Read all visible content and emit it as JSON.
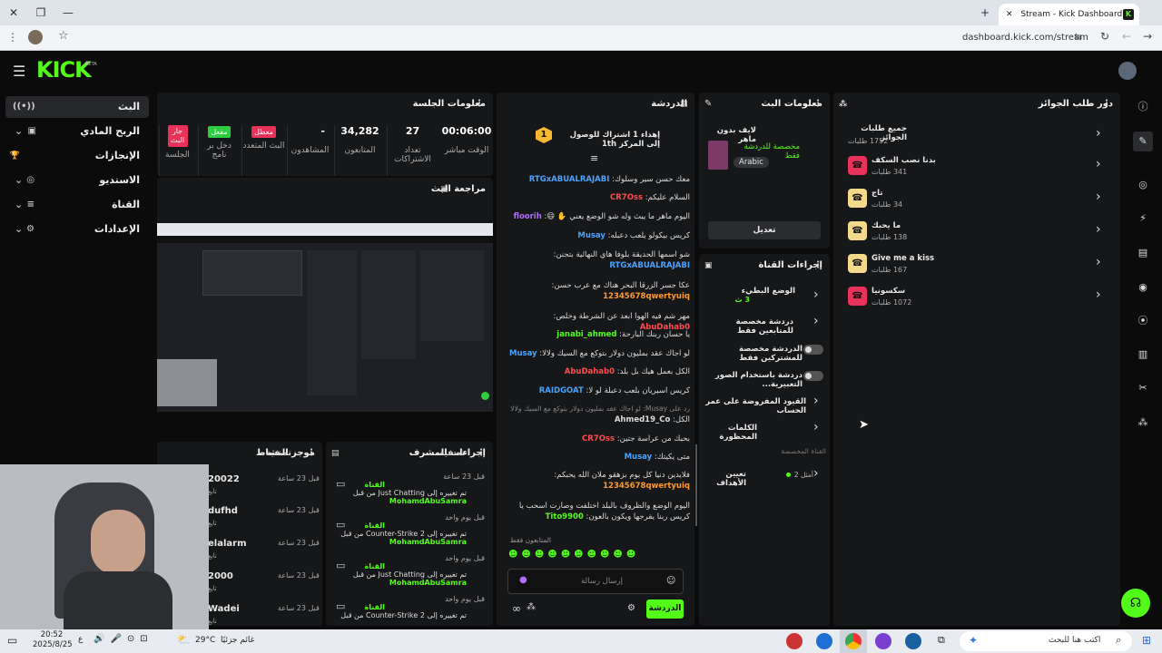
{
  "browser": {
    "tab_title": "Stream - Kick Dashboard",
    "url": "dashboard.kick.com/stream",
    "min": "—",
    "restore": "❐",
    "close": "✕",
    "newtab": "+"
  },
  "header": {
    "logo": "KICK",
    "beta": "BETA"
  },
  "sidebar": {
    "items": [
      {
        "label": "البث",
        "icon": "((•))"
      },
      {
        "label": "الربح المادي",
        "icon": "▣"
      },
      {
        "label": "الإنجازات",
        "icon": "🏆"
      },
      {
        "label": "الاستديو",
        "icon": "◎"
      },
      {
        "label": "القناة",
        "icon": "≡"
      },
      {
        "label": "الإعدادات",
        "icon": "⚙"
      }
    ]
  },
  "session": {
    "title": "معلومات الجلسة",
    "stats": [
      {
        "value": "00:06:00",
        "label": "الوقت مباشر"
      },
      {
        "value": "27",
        "label": "تعداد الاشتراكات"
      },
      {
        "value": "34,282",
        "label": "المتابعون"
      },
      {
        "value": "-",
        "label": "المشاهدون"
      },
      {
        "value": "معطل",
        "label": "البث المتعدد"
      },
      {
        "value": "مفعل",
        "label": "دخل بر نامج"
      },
      {
        "value": "جار البث",
        "label": "الجلسة"
      }
    ]
  },
  "preview": {
    "title": "مراجعة البث"
  },
  "activity": {
    "title": "موجز النشاط",
    "filter": "تصفية",
    "items": [
      {
        "name": "20022",
        "sub": "تابع",
        "time": "قبل 23 ساعة"
      },
      {
        "name": "dufhd",
        "sub": "تابع",
        "time": "قبل 23 ساعة"
      },
      {
        "name": "elalarm",
        "sub": "تابع",
        "time": "قبل 23 ساعة"
      },
      {
        "name": "2000",
        "sub": "تابع",
        "time": "قبل 23 ساعة"
      },
      {
        "name": "Wadei",
        "sub": "تابع",
        "time": "قبل 23 ساعة"
      }
    ]
  },
  "modactions": {
    "title": "إجراءات المشرف",
    "filter": "تصفية",
    "items": [
      {
        "time": "قبل 23 ساعة",
        "head": "القناة",
        "line1": "تم تغييره إلى Just Chatting من قبل",
        "line2": "MohamdAbuSamra"
      },
      {
        "time": "قبل يوم واحد",
        "head": "القناة",
        "line1": "تم تغييره إلى Counter-Strike 2 من قبل",
        "line2": "MohamdAbuSamra"
      },
      {
        "time": "قبل يوم واحد",
        "head": "القناة",
        "line1": "تم تغييره إلى Just Chatting من قبل",
        "line2": "MohamdAbuSamra"
      },
      {
        "time": "قبل يوم واحد",
        "head": "القناة",
        "line1": "تم تغييره إلى Counter-Strike 2 من قبل",
        "line2": ""
      }
    ]
  },
  "chat": {
    "title": "الدردشة",
    "pinned": "إهداء 1 اشتراك للوصول إلى المركز 1th",
    "messages": [
      {
        "user": "RTGxABUALRAJABI",
        "color": "#4aa3ff",
        "text": "معك حسن سير وسلوك"
      },
      {
        "user": "CR7Oss",
        "color": "#ff4d4d",
        "text": "السلام عليكم"
      },
      {
        "user": "floorih",
        "color": "#b46bff",
        "text": "اليوم ماهر ما يبث وله شو الوضع يعني ✋ 😄"
      },
      {
        "user": "Musay",
        "color": "#4aa3ff",
        "text": "كريس بيكولو يلعب دعبله"
      },
      {
        "user": "RTGxABUALRAJABI",
        "color": "#4aa3ff",
        "text": "شو اسمها الحديقة بلوفا هاي النهائية بتجنن"
      },
      {
        "user": "12345678qwertyuiq",
        "color": "#ff9a2e",
        "text": "عكا جسر الزرقا البحر هناك مع عرب حسن"
      },
      {
        "user": "AbuDahab0",
        "color": "#ff4d4d",
        "text": "مهر شم فيه الهوا ابعد عن الشرطة وخلص"
      },
      {
        "user": "janabi_ahmed",
        "color": "#53fc18",
        "text": "يا حسان ربنك البارحة"
      },
      {
        "user": "Musay",
        "color": "#4aa3ff",
        "text": "لو اجاك عقد بمليون دولار بتوكع مع السيك ولالا"
      },
      {
        "user": "AbuDahab0",
        "color": "#ff4d4d",
        "text": "الكل بعمل هيك بل بلد"
      },
      {
        "user": "RAIDGOAT",
        "color": "#4aa3ff",
        "text": "كريس اسيريان بلعب دعبلة لو لا"
      },
      {
        "user": "Ahmed19_Co",
        "color": "#dddddd",
        "text": "الكل"
      },
      {
        "user": "CR7Oss",
        "color": "#ff4d4d",
        "text": "بحبك من عراسة جتين"
      },
      {
        "user": "Musay",
        "color": "#4aa3ff",
        "text": "متى يكيتك"
      },
      {
        "user": "12345678qwertyuiq",
        "color": "#ff9a2e",
        "text": "فلايدين دنيا كل يوم بزهقو ملان الله يحبكم"
      },
      {
        "user": "Tito9900",
        "color": "#53fc18",
        "text": "اليوم الوضع والظروف بالبلد اختلفت وصارت اسحب يا كريس ربنا يفرجها ويكون بالعون"
      }
    ],
    "reply_hint": "رد على Musay: لو اجاك عقد بمليون دولار بتوكع مع السيك ولالا",
    "followers_only": "المتابعون فقط",
    "placeholder": "إرسال رسالة",
    "send": "الدردشة"
  },
  "streaminfo": {
    "title": "معلومات البث",
    "stream_title": "لايف بدون ماهر",
    "category": "مخصصة للدردشة فقط",
    "language": "Arabic",
    "edit": "تعديل"
  },
  "channelactions": {
    "title": "إجراءات القناة",
    "items": [
      {
        "label": "الوضع البطيء",
        "sub": "3 ث",
        "kind": "chev"
      },
      {
        "label": "دردشة مخصصة للمتابعين فقط",
        "sub": "",
        "kind": "chev"
      },
      {
        "label": "الدردشة مخصصة للمشتركين فقط",
        "sub": "",
        "kind": "toggle"
      },
      {
        "label": "دردشة باستخدام الصور التعبيرية...",
        "sub": "",
        "kind": "toggle"
      },
      {
        "label": "القيود المفروضة على عمر الحساب",
        "sub": "",
        "kind": "chev"
      },
      {
        "label": "الكلمات المحظورة",
        "sub": "",
        "kind": "chev"
      }
    ],
    "section": "القناة المخصصة",
    "goals_label": "تعيين الأهداف",
    "goals_value": "أمثل 2"
  },
  "rewards": {
    "title": "دور طلب الجوائز",
    "all_label": "جميع طلبات الجوائز",
    "all_count": "1752 طلبات",
    "items": [
      {
        "label": "بدنا نصب السكف",
        "count": "341 طلبات",
        "color": "#e8325a"
      },
      {
        "label": "تاج",
        "count": "34 طلبات",
        "color": "#f5d98a"
      },
      {
        "label": "ما يحبك",
        "count": "138 طلبات",
        "color": "#f5d98a"
      },
      {
        "label": "Give me a kiss",
        "count": "167 طلبات",
        "color": "#f5d98a"
      },
      {
        "label": "سكسونيا",
        "count": "1072 طلبات",
        "color": "#e8325a"
      }
    ]
  },
  "taskbar": {
    "time": "20:52",
    "date": "2025/8/25",
    "weather": "29°C",
    "weather_text": "غائم جزئيًا",
    "search": "اكتب هنا للبحث",
    "lang": "ع"
  }
}
